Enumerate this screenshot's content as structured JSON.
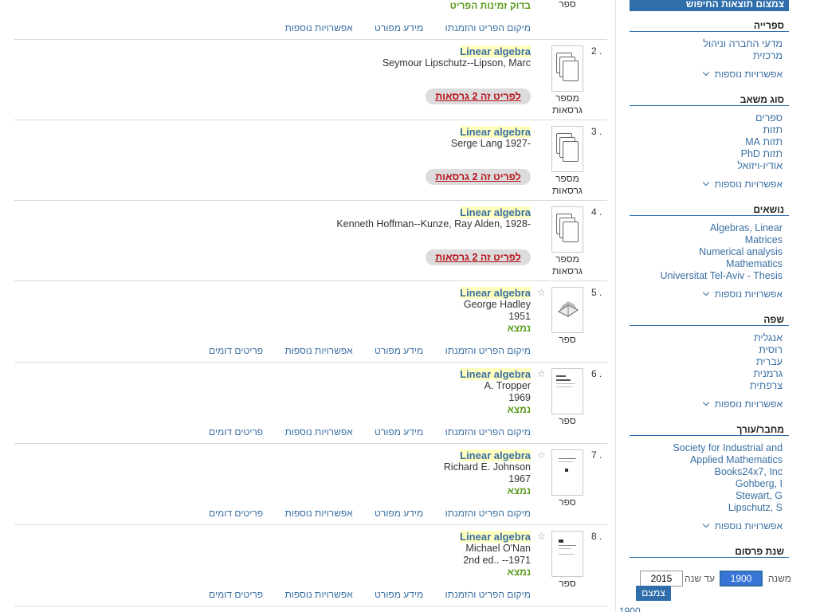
{
  "sidebar": {
    "header": "צמצום תוצאות החיפוש",
    "facets": [
      {
        "title": "ספרייה",
        "items": [
          "מדעי החברה וניהול",
          "מרכזית"
        ],
        "more": "אפשרויות נוספות"
      },
      {
        "title": "סוג משאב",
        "items": [
          "ספרים",
          "תזות",
          "תזות MA",
          "תזות PhD",
          "אודיו-ויזואל"
        ],
        "more": "אפשרויות נוספות"
      },
      {
        "title": "נושאים",
        "items": [
          "Algebras, Linear",
          "Matrices",
          "Numerical analysis",
          "Mathematics",
          "Universitat Tel-Aviv - Thesis"
        ],
        "more": "אפשרויות נוספות"
      },
      {
        "title": "שפה",
        "items": [
          "אנגלית",
          "רוסית",
          "עברית",
          "גרמנית",
          "צרפתית"
        ],
        "more": "אפשרויות נוספות"
      },
      {
        "title": "מחבר/עורך",
        "items": [
          "Society for Industrial and",
          "Applied Mathematics",
          "Books24x7, Inc",
          "Gohberg, I",
          "Stewart, G",
          "Lipschutz, S"
        ],
        "more": "אפשרויות נוספות"
      }
    ],
    "year": {
      "title": "שנת פרסום",
      "from_label": "משנה",
      "from_value": "1900",
      "to_label": "עד שנה",
      "to_value": "2015",
      "button": "צמצם"
    },
    "bottom_stub": "1900"
  },
  "results": {
    "top_partial": {
      "availability": "בדוק זמינות הפריט",
      "type": "ספר",
      "links": [
        "מיקום הפריט והזמנתו",
        "מידע מפורט",
        "אפשרויות נוספות"
      ]
    },
    "items": [
      {
        "num": "2 .",
        "title": "Linear algebra",
        "meta": [
          "Seymour Lipschutz--Lipson, Marc"
        ],
        "kind": "versions",
        "versions": "לפריט זה 2 גרסאות",
        "type_label": [
          "מספר",
          "גרסאות"
        ]
      },
      {
        "num": "3 .",
        "title": "Linear algebra",
        "meta": [
          "Serge Lang 1927-"
        ],
        "kind": "versions",
        "versions": "לפריט זה 2 גרסאות",
        "type_label": [
          "מספר",
          "גרסאות"
        ]
      },
      {
        "num": "4 .",
        "title": "Linear algebra",
        "meta": [
          "Kenneth Hoffman--Kunze, Ray Alden, 1928-"
        ],
        "kind": "versions",
        "versions": "לפריט זה 2 גרסאות",
        "type_label": [
          "מספר",
          "גרסאות"
        ]
      },
      {
        "num": "5 .",
        "title": "Linear algebra",
        "meta": [
          "George Hadley",
          "1951"
        ],
        "kind": "book",
        "availability": "נמצא",
        "type_label": [
          "ספר"
        ],
        "links": [
          "מיקום הפריט והזמנתו",
          "מידע מפורט",
          "אפשרויות נוספות",
          "פריטים דומים"
        ]
      },
      {
        "num": "6 .",
        "title": "Linear algebra",
        "meta": [
          "A. Tropper",
          "1969"
        ],
        "kind": "book",
        "availability": "נמצא",
        "type_label": [
          "ספר"
        ],
        "links": [
          "מיקום הפריט והזמנתו",
          "מידע מפורט",
          "אפשרויות נוספות",
          "פריטים דומים"
        ]
      },
      {
        "num": "7 .",
        "title": "Linear algebra",
        "meta": [
          "Richard E. Johnson",
          "1967"
        ],
        "kind": "book",
        "availability": "נמצא",
        "type_label": [
          "ספר"
        ],
        "links": [
          "מיקום הפריט והזמנתו",
          "מידע מפורט",
          "אפשרויות נוספות",
          "פריטים דומים"
        ]
      },
      {
        "num": "8 .",
        "title": "Linear algebra",
        "meta": [
          "Michael O'Nan",
          "2nd ed.. --1971"
        ],
        "kind": "book",
        "availability": "נמצא",
        "type_label": [
          "ספר"
        ],
        "links": [
          "מיקום הפריט והזמנתו",
          "מידע מפורט",
          "אפשרויות נוספות",
          "פריטים דומים"
        ]
      }
    ]
  }
}
